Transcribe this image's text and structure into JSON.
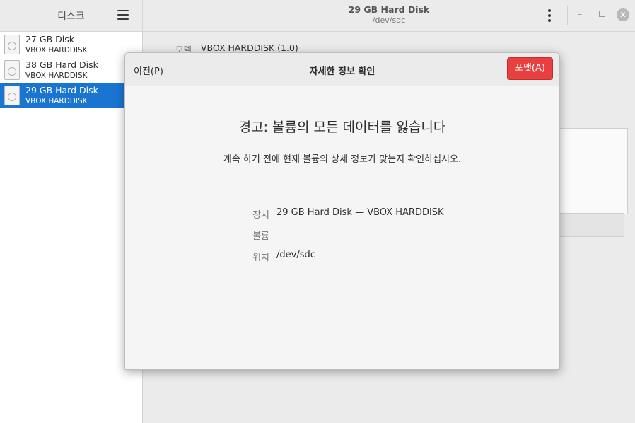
{
  "sidebar": {
    "title": "디스크",
    "menu_icon": "hamburger-menu-icon",
    "disks": [
      {
        "name": "27 GB Disk",
        "model": "VBOX HARDDISK",
        "selected": false
      },
      {
        "name": "38 GB Hard Disk",
        "model": "VBOX HARDDISK",
        "selected": false
      },
      {
        "name": "29 GB Hard Disk",
        "model": "VBOX HARDDISK",
        "selected": true
      }
    ]
  },
  "header": {
    "title": "29 GB Hard Disk",
    "subtitle": "/dev/sdc",
    "min_glyph": "–",
    "close_glyph": "✕"
  },
  "main": {
    "model_label": "모델",
    "model_value": "VBOX HARDDISK (1.0)"
  },
  "dialog": {
    "title": "자세한 정보 확인",
    "back_label": "이전(P)",
    "format_label": "포맷(A)",
    "warning_title": "경고: 볼륨의 모든 데이터를 잃습니다",
    "warning_desc": "계속 하기 전에 현재 볼륨의 상세 정보가 맞는지 확인하십시오.",
    "details": [
      {
        "label": "장치",
        "value": "29 GB Hard Disk — VBOX HARDDISK"
      },
      {
        "label": "볼륨",
        "value": ""
      },
      {
        "label": "위치",
        "value": "/dev/sdc"
      }
    ]
  },
  "colors": {
    "accent": "#1a75d1",
    "destructive": "#ea3f3f"
  }
}
